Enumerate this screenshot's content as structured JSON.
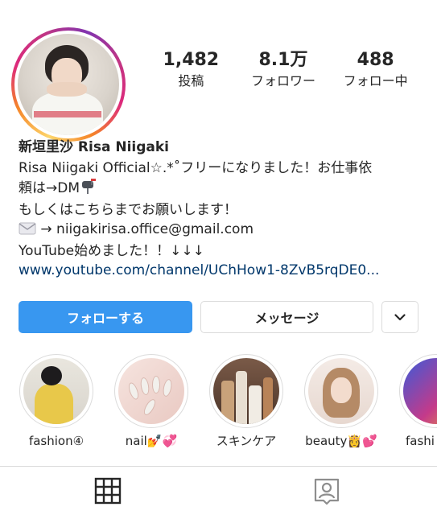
{
  "profile": {
    "stats": [
      {
        "value": "1,482",
        "label": "投稿"
      },
      {
        "value": "8.1万",
        "label": "フォロワー"
      },
      {
        "value": "488",
        "label": "フォロー中"
      }
    ],
    "name": "新垣里沙 Risa Niigaki",
    "bio_lines": [
      "Risa Niigaki Official☆.*˚フリーになりました！お仕事依",
      "頼は→DM",
      "もしくはこちらまでお願いします！",
      "→ niigakirisa.office@gmail.com",
      "YouTube始めました！！↓↓↓"
    ],
    "link": "www.youtube.com/channel/UChHow1-8ZvB5rqDE0..."
  },
  "actions": {
    "follow_label": "フォローする",
    "message_label": "メッセージ",
    "more_icon": "chevron-down-icon"
  },
  "highlights": [
    {
      "label": "fashion④"
    },
    {
      "label": "nail💅💞"
    },
    {
      "label": "スキンケア"
    },
    {
      "label": "beauty👸💕"
    },
    {
      "label": "fashi"
    }
  ],
  "tabs": [
    {
      "icon": "grid-icon"
    },
    {
      "icon": "tagged-person-icon"
    }
  ],
  "colors": {
    "accent": "#3897f0",
    "link": "#00376b",
    "border": "#dbdbdb",
    "text": "#262626"
  }
}
